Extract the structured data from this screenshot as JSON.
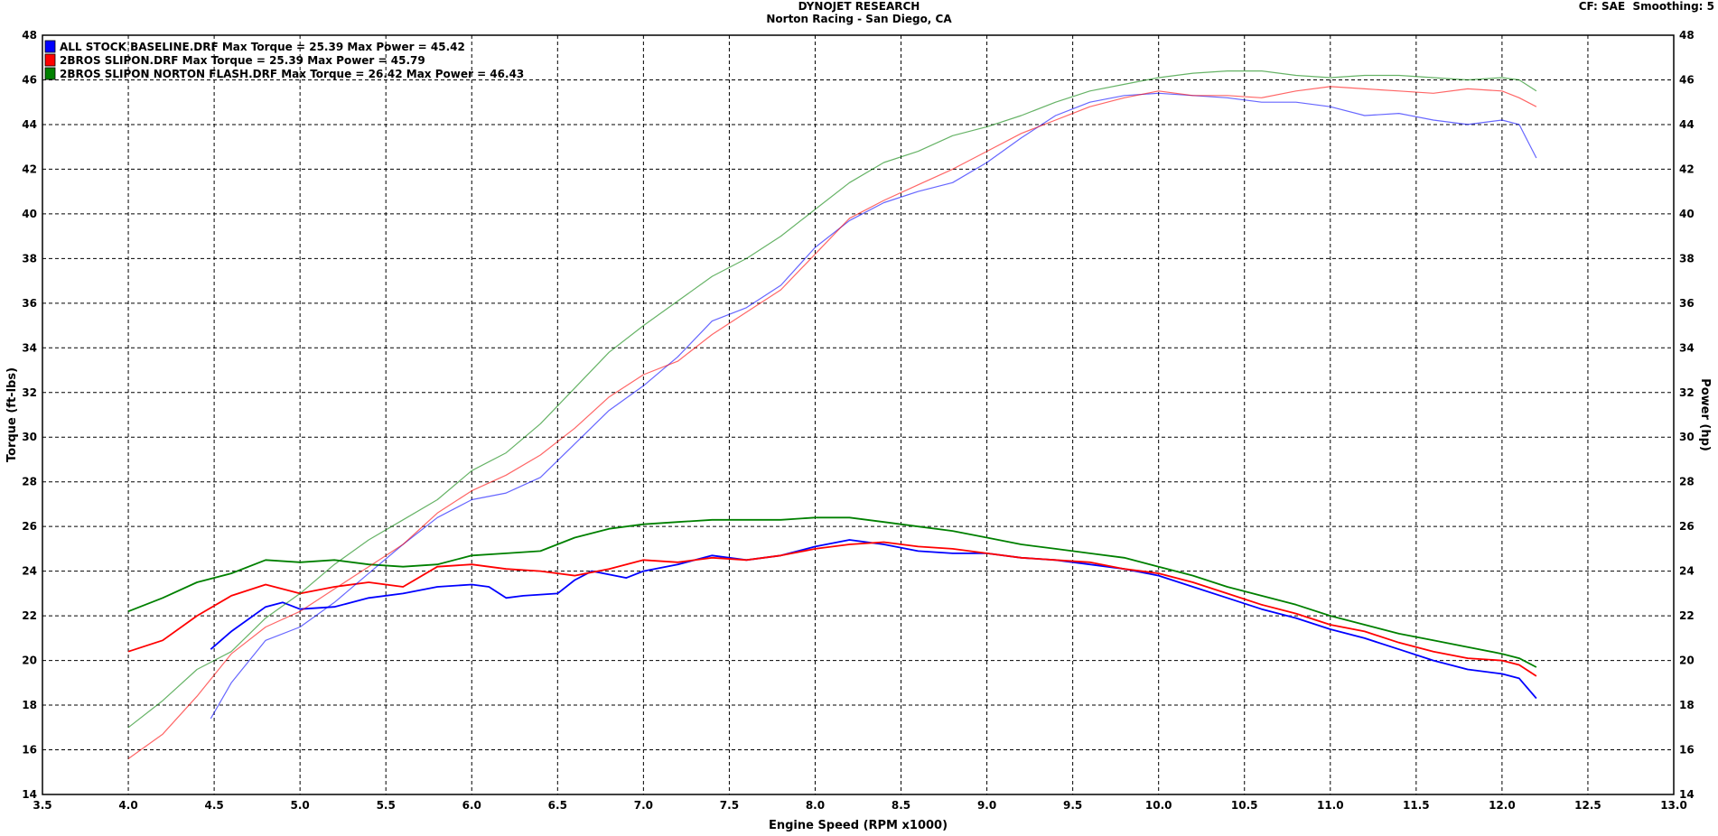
{
  "header": {
    "title": "DYNOJET RESEARCH",
    "subtitle": "Norton Racing - San Diego, CA",
    "cf_label": "CF: SAE",
    "smoothing_label": "Smoothing: 5"
  },
  "chart_data": {
    "type": "line",
    "title": "DYNOJET RESEARCH",
    "subtitle": "Norton Racing - San Diego, CA",
    "xlabel": "Engine Speed (RPM x1000)",
    "ylabel": "Torque (ft-lbs)",
    "y2label": "Power (hp)",
    "xlim": [
      3.5,
      13.0
    ],
    "ylim": [
      14,
      48
    ],
    "y2lim": [
      14,
      48
    ],
    "x_ticks": [
      "3.5",
      "4.0",
      "4.5",
      "5.0",
      "5.5",
      "6.0",
      "6.5",
      "7.0",
      "7.5",
      "8.0",
      "8.5",
      "9.0",
      "9.5",
      "10.0",
      "10.5",
      "11.0",
      "11.5",
      "12.0",
      "12.5",
      "13.0"
    ],
    "y_ticks": [
      "14",
      "16",
      "18",
      "20",
      "22",
      "24",
      "26",
      "28",
      "30",
      "32",
      "34",
      "36",
      "38",
      "40",
      "42",
      "44",
      "46",
      "48"
    ],
    "grid": true,
    "legend_position": "top-left",
    "legend": [
      {
        "label": "ALL STOCK BASELINE.DRF Max Torque = 25.39 Max Power = 45.42",
        "color": "#0000ff"
      },
      {
        "label": "2BROS SLIPON.DRF Max Torque = 25.39 Max Power = 45.79",
        "color": "#ff0000"
      },
      {
        "label": "2BROS SLIPON NORTON FLASH.DRF Max Torque = 26.42 Max Power = 46.43",
        "color": "#008000"
      }
    ],
    "series": [
      {
        "name": "ALL STOCK BASELINE.DRF",
        "measure": "torque",
        "color": "#0000ff",
        "x": [
          4.48,
          4.6,
          4.8,
          4.9,
          5.0,
          5.2,
          5.4,
          5.6,
          5.8,
          6.0,
          6.1,
          6.2,
          6.3,
          6.5,
          6.6,
          6.7,
          6.9,
          7.0,
          7.2,
          7.4,
          7.6,
          7.8,
          8.0,
          8.2,
          8.4,
          8.6,
          8.8,
          9.0,
          9.2,
          9.4,
          9.6,
          9.8,
          10.0,
          10.2,
          10.4,
          10.6,
          10.8,
          11.0,
          11.2,
          11.4,
          11.6,
          11.8,
          12.0,
          12.1,
          12.2
        ],
        "y": [
          20.5,
          21.3,
          22.4,
          22.6,
          22.3,
          22.4,
          22.8,
          23.0,
          23.3,
          23.4,
          23.3,
          22.8,
          22.9,
          23.0,
          23.6,
          24.0,
          23.7,
          24.0,
          24.3,
          24.7,
          24.5,
          24.7,
          25.1,
          25.4,
          25.2,
          24.9,
          24.8,
          24.8,
          24.6,
          24.5,
          24.3,
          24.1,
          23.8,
          23.3,
          22.8,
          22.3,
          21.9,
          21.4,
          21.0,
          20.5,
          20.0,
          19.6,
          19.4,
          19.2,
          18.3
        ]
      },
      {
        "name": "2BROS SLIPON.DRF",
        "measure": "torque",
        "color": "#ff0000",
        "x": [
          4.0,
          4.2,
          4.4,
          4.6,
          4.8,
          5.0,
          5.2,
          5.4,
          5.6,
          5.8,
          6.0,
          6.2,
          6.4,
          6.6,
          6.8,
          7.0,
          7.2,
          7.4,
          7.6,
          7.8,
          8.0,
          8.2,
          8.4,
          8.6,
          8.8,
          9.0,
          9.2,
          9.4,
          9.6,
          9.8,
          10.0,
          10.2,
          10.4,
          10.6,
          10.8,
          11.0,
          11.2,
          11.4,
          11.6,
          11.8,
          12.0,
          12.1,
          12.2
        ],
        "y": [
          20.4,
          20.9,
          22.0,
          22.9,
          23.4,
          23.0,
          23.3,
          23.5,
          23.3,
          24.2,
          24.3,
          24.1,
          24.0,
          23.8,
          24.1,
          24.5,
          24.4,
          24.6,
          24.5,
          24.7,
          25.0,
          25.2,
          25.3,
          25.1,
          25.0,
          24.8,
          24.6,
          24.5,
          24.4,
          24.1,
          23.9,
          23.5,
          23.0,
          22.5,
          22.1,
          21.6,
          21.3,
          20.8,
          20.4,
          20.1,
          20.0,
          19.8,
          19.3
        ]
      },
      {
        "name": "2BROS SLIPON NORTON FLASH.DRF",
        "measure": "torque",
        "color": "#008000",
        "x": [
          4.0,
          4.2,
          4.4,
          4.6,
          4.8,
          5.0,
          5.2,
          5.4,
          5.6,
          5.8,
          6.0,
          6.2,
          6.4,
          6.6,
          6.8,
          7.0,
          7.2,
          7.4,
          7.6,
          7.8,
          8.0,
          8.2,
          8.4,
          8.6,
          8.8,
          9.0,
          9.2,
          9.4,
          9.6,
          9.8,
          10.0,
          10.2,
          10.4,
          10.6,
          10.8,
          11.0,
          11.2,
          11.4,
          11.6,
          11.8,
          12.0,
          12.1,
          12.2
        ],
        "y": [
          22.2,
          22.8,
          23.5,
          23.9,
          24.5,
          24.4,
          24.5,
          24.3,
          24.2,
          24.3,
          24.7,
          24.8,
          24.9,
          25.5,
          25.9,
          26.1,
          26.2,
          26.3,
          26.3,
          26.3,
          26.4,
          26.4,
          26.2,
          26.0,
          25.8,
          25.5,
          25.2,
          25.0,
          24.8,
          24.6,
          24.2,
          23.8,
          23.3,
          22.9,
          22.5,
          22.0,
          21.6,
          21.2,
          20.9,
          20.6,
          20.3,
          20.1,
          19.7
        ]
      },
      {
        "name": "ALL STOCK BASELINE.DRF",
        "measure": "power",
        "color": "#0000ff",
        "x": [
          4.48,
          4.6,
          4.8,
          5.0,
          5.2,
          5.4,
          5.6,
          5.8,
          6.0,
          6.2,
          6.4,
          6.6,
          6.8,
          7.0,
          7.2,
          7.4,
          7.6,
          7.8,
          8.0,
          8.2,
          8.4,
          8.6,
          8.8,
          9.0,
          9.2,
          9.4,
          9.6,
          9.8,
          10.0,
          10.2,
          10.4,
          10.6,
          10.8,
          11.0,
          11.2,
          11.4,
          11.6,
          11.8,
          12.0,
          12.1,
          12.2
        ],
        "y": [
          17.4,
          19.0,
          20.9,
          21.5,
          22.6,
          23.9,
          25.2,
          26.4,
          27.2,
          27.5,
          28.2,
          29.7,
          31.2,
          32.3,
          33.6,
          35.2,
          35.8,
          36.8,
          38.5,
          39.7,
          40.5,
          41.0,
          41.4,
          42.3,
          43.4,
          44.4,
          45.0,
          45.3,
          45.4,
          45.3,
          45.2,
          45.0,
          45.0,
          44.8,
          44.4,
          44.5,
          44.2,
          44.0,
          44.2,
          44.0,
          42.5
        ]
      },
      {
        "name": "2BROS SLIPON.DRF",
        "measure": "power",
        "color": "#ff0000",
        "x": [
          4.0,
          4.2,
          4.4,
          4.6,
          4.8,
          5.0,
          5.2,
          5.4,
          5.6,
          5.8,
          6.0,
          6.2,
          6.4,
          6.6,
          6.8,
          7.0,
          7.2,
          7.4,
          7.6,
          7.8,
          8.0,
          8.2,
          8.4,
          8.6,
          8.8,
          9.0,
          9.2,
          9.4,
          9.6,
          9.8,
          10.0,
          10.2,
          10.4,
          10.6,
          10.8,
          11.0,
          11.2,
          11.4,
          11.6,
          11.8,
          12.0,
          12.1,
          12.2
        ],
        "y": [
          15.6,
          16.7,
          18.4,
          20.3,
          21.5,
          22.2,
          23.2,
          24.2,
          25.2,
          26.6,
          27.6,
          28.3,
          29.2,
          30.4,
          31.8,
          32.8,
          33.4,
          34.6,
          35.6,
          36.6,
          38.2,
          39.8,
          40.6,
          41.3,
          42.0,
          42.8,
          43.6,
          44.2,
          44.8,
          45.2,
          45.5,
          45.3,
          45.3,
          45.2,
          45.5,
          45.7,
          45.6,
          45.5,
          45.4,
          45.6,
          45.5,
          45.2,
          44.8
        ]
      },
      {
        "name": "2BROS SLIPON NORTON FLASH.DRF",
        "measure": "power",
        "color": "#008000",
        "x": [
          4.0,
          4.2,
          4.4,
          4.6,
          4.8,
          5.0,
          5.2,
          5.4,
          5.6,
          5.8,
          6.0,
          6.2,
          6.4,
          6.6,
          6.8,
          7.0,
          7.2,
          7.4,
          7.6,
          7.8,
          8.0,
          8.2,
          8.4,
          8.6,
          8.8,
          9.0,
          9.2,
          9.4,
          9.6,
          9.8,
          10.0,
          10.2,
          10.4,
          10.6,
          10.8,
          11.0,
          11.2,
          11.4,
          11.6,
          11.8,
          12.0,
          12.1,
          12.2
        ],
        "y": [
          17.0,
          18.2,
          19.6,
          20.4,
          21.9,
          23.0,
          24.3,
          25.4,
          26.3,
          27.2,
          28.5,
          29.3,
          30.6,
          32.2,
          33.8,
          35.0,
          36.1,
          37.2,
          38.0,
          39.0,
          40.2,
          41.4,
          42.3,
          42.8,
          43.5,
          43.9,
          44.4,
          45.0,
          45.5,
          45.8,
          46.1,
          46.3,
          46.4,
          46.4,
          46.2,
          46.1,
          46.2,
          46.2,
          46.1,
          46.0,
          46.1,
          46.0,
          45.5
        ]
      }
    ]
  }
}
